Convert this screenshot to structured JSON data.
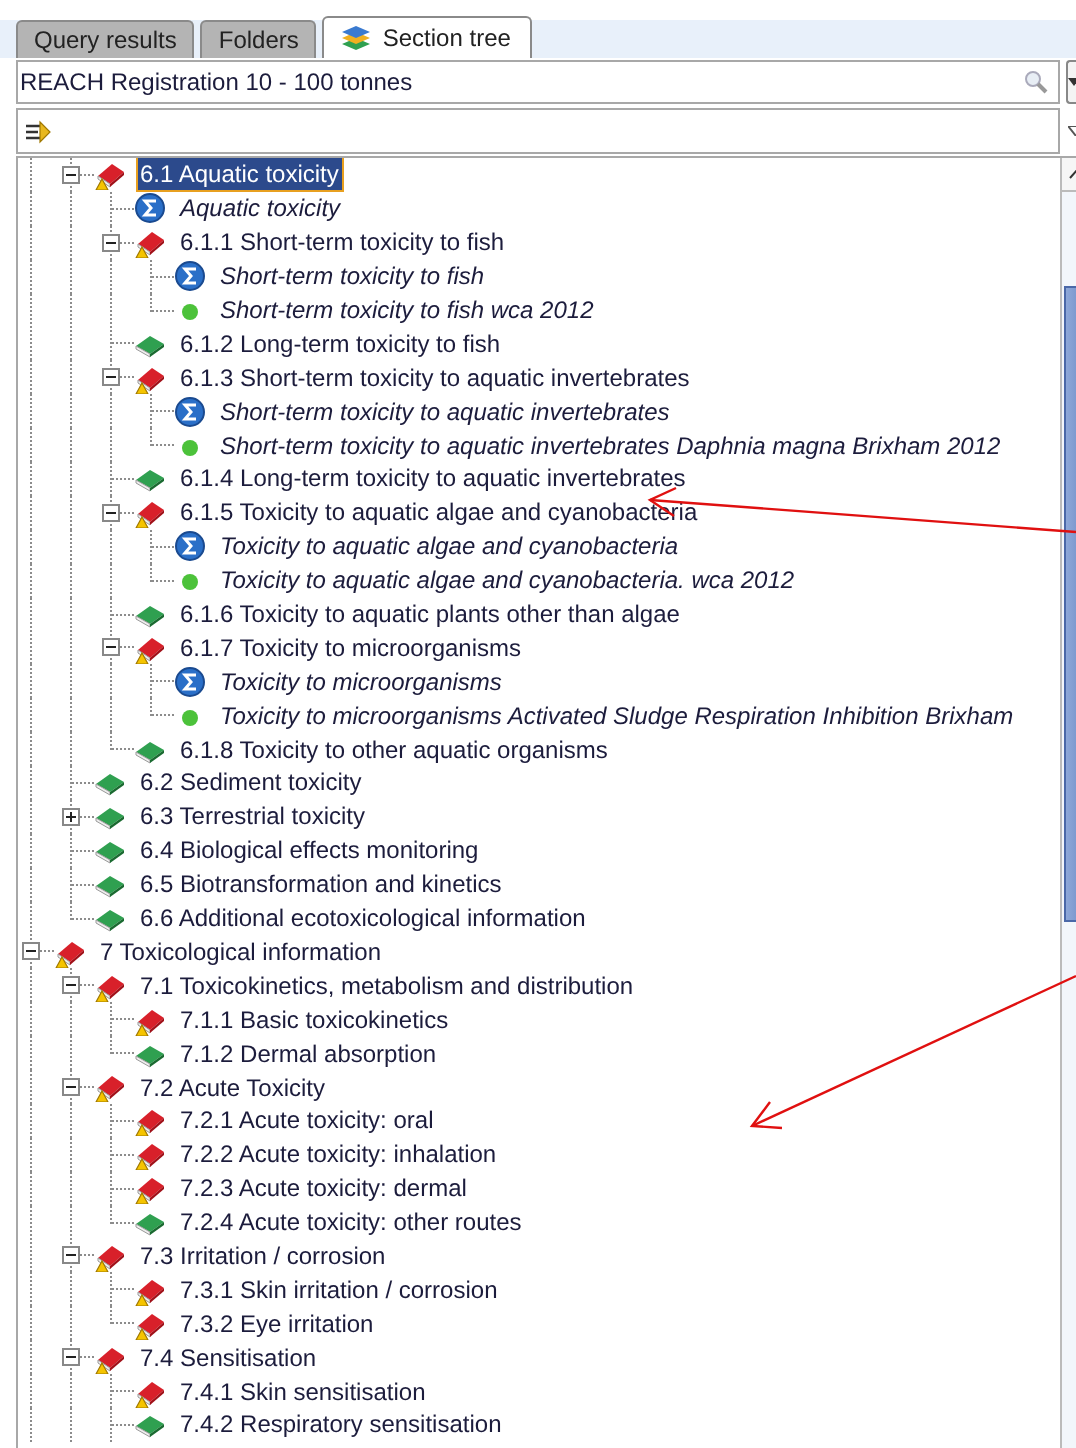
{
  "tabs": [
    {
      "label": "Query results",
      "selected": false
    },
    {
      "label": "Folders",
      "selected": false
    },
    {
      "label": "Section tree",
      "selected": true
    }
  ],
  "inventory": {
    "value": "REACH Registration 10 - 100 tonnes"
  },
  "tree": {
    "more_below": true,
    "items": [
      {
        "children": [
          {
            "label": "6.1 Aquatic toxicity",
            "kind": "section-warning",
            "expanded": true,
            "selected": true,
            "children": [
              {
                "label": "Aquatic toxicity",
                "kind": "summary",
                "selected": false
              },
              {
                "label": "6.1.1 Short-term toxicity to fish",
                "kind": "section-warning",
                "expanded": true,
                "selected": false,
                "children": [
                  {
                    "label": "Short-term toxicity to fish",
                    "kind": "summary",
                    "selected": false
                  },
                  {
                    "label": "Short-term toxicity to fish wca 2012",
                    "kind": "record",
                    "selected": false
                  }
                ]
              },
              {
                "label": "6.1.2 Long-term toxicity to fish",
                "kind": "section-done",
                "selected": false
              },
              {
                "label": "6.1.3 Short-term toxicity to aquatic invertebrates",
                "kind": "section-warning",
                "expanded": true,
                "selected": false,
                "children": [
                  {
                    "label": "Short-term toxicity to aquatic invertebrates",
                    "kind": "summary",
                    "selected": false
                  },
                  {
                    "label": "Short-term toxicity to aquatic invertebrates Daphnia magna Brixham 2012",
                    "kind": "record",
                    "selected": false
                  }
                ]
              },
              {
                "label": "6.1.4 Long-term toxicity to aquatic invertebrates",
                "kind": "section-done",
                "selected": false
              },
              {
                "label": "6.1.5 Toxicity to aquatic algae and cyanobacteria",
                "kind": "section-warning",
                "expanded": true,
                "selected": false,
                "children": [
                  {
                    "label": "Toxicity to aquatic algae and cyanobacteria",
                    "kind": "summary",
                    "selected": false
                  },
                  {
                    "label": "Toxicity to aquatic algae and cyanobacteria. wca 2012",
                    "kind": "record",
                    "selected": false
                  }
                ]
              },
              {
                "label": "6.1.6 Toxicity to aquatic plants other than algae",
                "kind": "section-done",
                "selected": false
              },
              {
                "label": "6.1.7 Toxicity to microorganisms",
                "kind": "section-warning",
                "expanded": true,
                "selected": false,
                "children": [
                  {
                    "label": "Toxicity to microorganisms",
                    "kind": "summary",
                    "selected": false
                  },
                  {
                    "label": "Toxicity to microorganisms Activated Sludge Respiration Inhibition Brixham",
                    "kind": "record",
                    "selected": false
                  }
                ]
              },
              {
                "label": "6.1.8 Toxicity to other aquatic organisms",
                "kind": "section-done",
                "selected": false
              }
            ]
          },
          {
            "label": "6.2 Sediment toxicity",
            "kind": "section-done",
            "selected": false
          },
          {
            "label": "6.3 Terrestrial toxicity",
            "kind": "section-done",
            "expanded": false,
            "selected": false
          },
          {
            "label": "6.4 Biological effects monitoring",
            "kind": "section-done",
            "selected": false
          },
          {
            "label": "6.5 Biotransformation and kinetics",
            "kind": "section-done",
            "selected": false
          },
          {
            "label": "6.6 Additional ecotoxicological information",
            "kind": "section-done",
            "selected": false
          }
        ]
      },
      {
        "label": "7 Toxicological information",
        "kind": "section-warning",
        "expanded": true,
        "selected": false,
        "children": [
          {
            "label": "7.1 Toxicokinetics, metabolism and distribution",
            "kind": "section-warning",
            "expanded": true,
            "selected": false,
            "children": [
              {
                "label": "7.1.1 Basic toxicokinetics",
                "kind": "section-warning",
                "selected": false
              },
              {
                "label": "7.1.2 Dermal absorption",
                "kind": "section-done",
                "selected": false
              }
            ]
          },
          {
            "label": "7.2 Acute Toxicity",
            "kind": "section-warning",
            "expanded": true,
            "selected": false,
            "children": [
              {
                "label": "7.2.1 Acute toxicity: oral",
                "kind": "section-warning",
                "selected": false
              },
              {
                "label": "7.2.2 Acute toxicity: inhalation",
                "kind": "section-warning",
                "selected": false
              },
              {
                "label": "7.2.3 Acute toxicity: dermal",
                "kind": "section-warning",
                "selected": false
              },
              {
                "label": "7.2.4 Acute toxicity: other routes",
                "kind": "section-done",
                "selected": false
              }
            ]
          },
          {
            "label": "7.3 Irritation / corrosion",
            "kind": "section-warning",
            "expanded": true,
            "selected": false,
            "children": [
              {
                "label": "7.3.1 Skin irritation / corrosion",
                "kind": "section-warning",
                "selected": false
              },
              {
                "label": "7.3.2 Eye irritation",
                "kind": "section-warning",
                "selected": false
              }
            ]
          },
          {
            "label": "7.4 Sensitisation",
            "kind": "section-warning",
            "expanded": true,
            "selected": false,
            "children": [
              {
                "label": "7.4.1 Skin sensitisation",
                "kind": "section-warning",
                "selected": false
              },
              {
                "label": "7.4.2 Respiratory sensitisation",
                "kind": "section-done",
                "selected": false
              }
            ]
          }
        ]
      }
    ]
  }
}
